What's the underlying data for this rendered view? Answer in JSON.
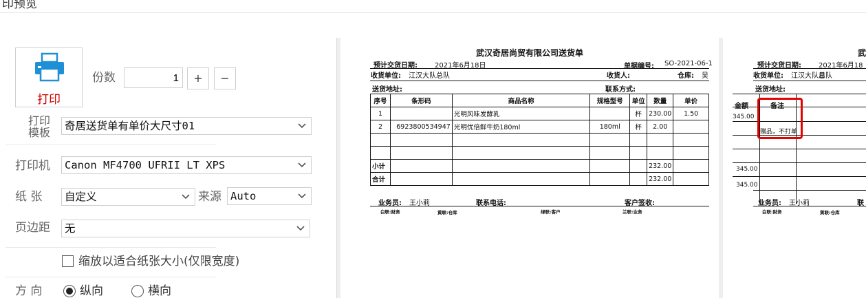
{
  "window": {
    "title": "打印预览"
  },
  "print_button": {
    "label": "打印",
    "icon": "printer-icon"
  },
  "copies": {
    "label": "份数",
    "value": "1",
    "plus": "+",
    "minus": "−"
  },
  "template": {
    "label_line1": "打印",
    "label_line2": "模板",
    "value": "奇居送货单有单价大尺寸01"
  },
  "printer": {
    "label": "打印机",
    "value": "Canon MF4700 UFRII LT XPS"
  },
  "paper": {
    "label": "纸  张",
    "value": "自定义",
    "source_label": "来源",
    "source_value": "Auto"
  },
  "margin": {
    "label": "页边距",
    "value": "无"
  },
  "scale": {
    "label": "缩放以适合纸张大小(仅限宽度)",
    "checked": false
  },
  "orientation": {
    "label": "方  向",
    "portrait": "纵向",
    "landscape": "横向",
    "selected": "portrait"
  },
  "page1": {
    "company": "武汉奇居尚贸有限公司送货单",
    "delivery_date_label": "预计交货日期:",
    "delivery_date": "2021年6月18日",
    "doc_no_label": "单据编号:",
    "doc_no": "SO-2021-06-1",
    "receiver_unit_label": "收货单位:",
    "receiver_unit": "江汉大队总队",
    "receiver_label": "收货人:",
    "warehouse_label": "仓库:",
    "warehouse": "吴",
    "address_label": "送货地址:",
    "contact_label": "联系方式:",
    "headers": [
      "序号",
      "条形码",
      "商品名称",
      "规格型号",
      "单位",
      "数量",
      "单价"
    ],
    "rows": [
      [
        "1",
        "",
        "光明风味发酵乳",
        "",
        "杯",
        "230.00",
        "1.50"
      ],
      [
        "2",
        "6923800534947",
        "光明优倍鲜牛奶180ml",
        "180ml",
        "杯",
        "2.00",
        ""
      ],
      [
        "",
        "",
        "",
        "",
        "",
        "",
        ""
      ],
      [
        "",
        "",
        "",
        "",
        "",
        "",
        ""
      ]
    ],
    "subtotal_label": "小计",
    "subtotal": "232.00",
    "total_label": "合计",
    "total": "232.00",
    "salesperson_label": "业务员:",
    "salesperson": "王小莉",
    "phone_label": "联系电话:",
    "customer_sign_label": "客户签收:",
    "copy1": "白联:财务",
    "copy2": "黄联:仓库",
    "copy3": "绿联:客户",
    "copy4": "兰联:业务"
  },
  "page2": {
    "company_fragment": "武",
    "delivery_date_label": "预计交货日期:",
    "delivery_date": "2021年6月18日",
    "receiver_unit_label": "收货单位:",
    "receiver_unit": "江汉大队总队",
    "address_label": "送货地址:",
    "amount_header": "金额",
    "remark_header": "备注",
    "row1_amount": "345.00",
    "row2_remark": "赠品，不打单",
    "subtotal_amount": "345.00",
    "total_amount": "345.00",
    "salesperson_label": "业务员:",
    "salesperson": "王小莉",
    "phone_label_fragment": "联",
    "copy1": "白联:财务",
    "copy2": "黄联:仓库"
  },
  "highlight_color": "#e60000"
}
